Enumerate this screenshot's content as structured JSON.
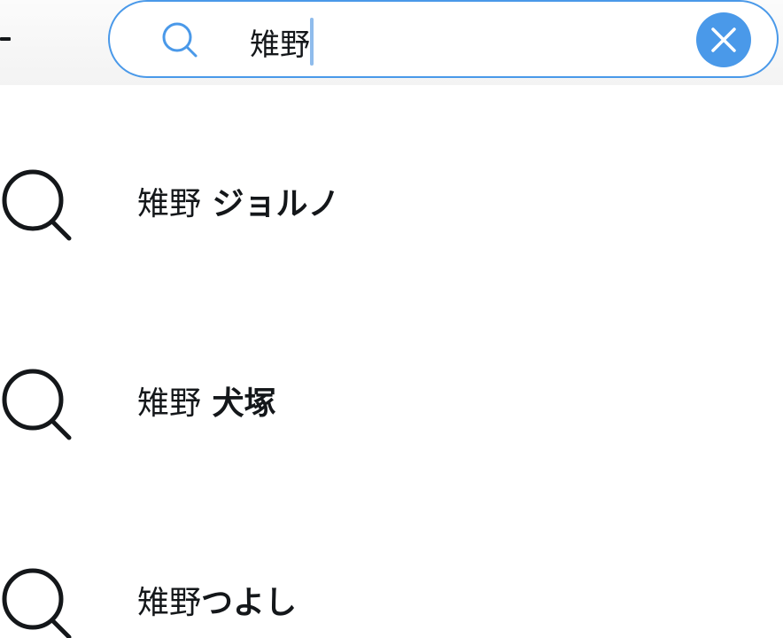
{
  "search": {
    "query": "雉野",
    "placeholder": "",
    "clear_label": "Clear search"
  },
  "icons": {
    "search": "search-icon",
    "clear": "close-icon",
    "back": "back-arrow-icon"
  },
  "colors": {
    "accent": "#4a99e9",
    "text": "#14171a",
    "caret": "#8fbcec"
  },
  "suggestions": [
    {
      "query_part": "雉野",
      "rest": " ジョルノ"
    },
    {
      "query_part": "雉野",
      "rest": " 犬塚"
    },
    {
      "query_part": "雉野",
      "rest": "つよし"
    }
  ]
}
